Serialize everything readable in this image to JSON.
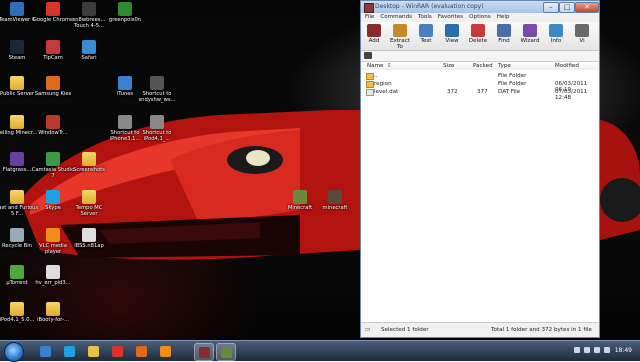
{
  "desktop": {
    "icons": [
      {
        "label": "TeamViewer 6",
        "icon": "teamviewer-icon",
        "color": "#2c6fb7"
      },
      {
        "label": "Google Chrome",
        "icon": "chrome-icon",
        "color": "#d8342b"
      },
      {
        "label": "sn8wbrees... Touch 4-5...",
        "icon": "app-icon",
        "color": "#3c3c3c"
      },
      {
        "label": "greenpois0n",
        "icon": "greenpois0n-icon",
        "color": "#2f8a2f"
      },
      {
        "label": "Steam",
        "icon": "steam-icon",
        "color": "#1b2838"
      },
      {
        "label": "TipCam",
        "icon": "tipcam-icon",
        "color": "#c23a3a"
      },
      {
        "label": "Safari",
        "icon": "safari-icon",
        "color": "#3a8bd6"
      },
      {
        "label": "Public Server",
        "icon": "folder-icon",
        "color": "#e8c04a"
      },
      {
        "label": "Samsung Kies",
        "icon": "kies-icon",
        "color": "#e06a1b"
      },
      {
        "label": "iTunes",
        "icon": "itunes-icon",
        "color": "#3d7fd1"
      },
      {
        "label": "Shortcut to sndyshw_ws...",
        "icon": "shortcut-icon",
        "color": "#555555"
      },
      {
        "label": "Selling Minecr...",
        "icon": "folder-icon",
        "color": "#e8c04a"
      },
      {
        "label": "WindowTr...",
        "icon": "windowtrans-icon",
        "color": "#b73a2a"
      },
      {
        "label": "Shortcut to iPhone3,1...",
        "icon": "shortcut-icon",
        "color": "#888888"
      },
      {
        "label": "Shortcut to iPod4,1_...",
        "icon": "shortcut-icon",
        "color": "#888888"
      },
      {
        "label": "Flatgrass...",
        "icon": "flatgrass-icon",
        "color": "#6b3fa0"
      },
      {
        "label": "Camtasia Studio 7",
        "icon": "camtasia-icon",
        "color": "#3a9a4a"
      },
      {
        "label": "Screenshots",
        "icon": "folder-icon",
        "color": "#e8c04a"
      },
      {
        "label": "Fast and Furious 5 F...",
        "icon": "folder-icon",
        "color": "#e8c04a"
      },
      {
        "label": "Skype",
        "icon": "skype-icon",
        "color": "#1fa0e0"
      },
      {
        "label": "Tempo MC Server",
        "icon": "folder-icon",
        "color": "#e8c04a"
      },
      {
        "label": "Minecraft",
        "icon": "minecraft-icon",
        "color": "#6a8a3a"
      },
      {
        "label": "minecraft",
        "icon": "minecraft-icon",
        "color": "#5a4a3a"
      },
      {
        "label": "Recycle Bin",
        "icon": "recycle-bin-icon",
        "color": "#9aa9b8"
      },
      {
        "label": "VLC media player",
        "icon": "vlc-icon",
        "color": "#f08c1a"
      },
      {
        "label": "iBSS.n81ap",
        "icon": "file-icon",
        "color": "#dddddd"
      },
      {
        "label": "µTorrent",
        "icon": "utorrent-icon",
        "color": "#4caa3c"
      },
      {
        "label": "hv_err_pid3...",
        "icon": "file-icon",
        "color": "#dddddd"
      },
      {
        "label": "iPod4,1_5.0...",
        "icon": "folder-icon",
        "color": "#e8c04a"
      },
      {
        "label": "iBooty-for-...",
        "icon": "folder-icon",
        "color": "#e8c04a"
      }
    ]
  },
  "winrar": {
    "title": "Desktop - WinRAR (evaluation copy)",
    "menu": [
      "File",
      "Commands",
      "Tools",
      "Favorites",
      "Options",
      "Help"
    ],
    "toolbar": [
      "Add",
      "Extract To",
      "Test",
      "View",
      "Delete",
      "Find",
      "Wizard",
      "Info",
      "Vi"
    ],
    "toolbar_colors": [
      "#8a2b2b",
      "#c78a2b",
      "#4a7fc1",
      "#2b6fa8",
      "#c73a3a",
      "#4a6fa8",
      "#7a4aa8",
      "#3a8ac1",
      "#6a6a6a"
    ],
    "columns": [
      "Name",
      "Size",
      "Packed",
      "Type",
      "Modified"
    ],
    "rows": [
      {
        "name": "..",
        "size": "",
        "packed": "",
        "type": "File Folder",
        "modified": "",
        "kind": "folder"
      },
      {
        "name": "region",
        "size": "",
        "packed": "",
        "type": "File Folder",
        "modified": "06/03/2011 06:19",
        "kind": "folder"
      },
      {
        "name": "level.dat",
        "size": "372",
        "packed": "377",
        "type": "DAT File",
        "modified": "07/03/2011 12:48",
        "kind": "file"
      }
    ],
    "status_left": "Selected 1 folder",
    "status_right": "Total 1 folder and 372 bytes in 1 file"
  },
  "taskbar": {
    "apps": [
      {
        "name": "ie-taskbar-icon",
        "color": "#3a7fd1"
      },
      {
        "name": "skype-taskbar-icon",
        "color": "#1fa0e0"
      },
      {
        "name": "explorer-taskbar-icon",
        "color": "#e8c04a"
      },
      {
        "name": "chrome-taskbar-icon",
        "color": "#d8342b"
      },
      {
        "name": "kies-taskbar-icon",
        "color": "#e06a1b"
      },
      {
        "name": "vlc-taskbar-icon",
        "color": "#f08c1a"
      },
      {
        "name": "winrar-taskbar-icon",
        "color": "#8a2b2b"
      },
      {
        "name": "minecraft-taskbar-icon",
        "color": "#6a8a3a"
      }
    ],
    "clock": "18:49"
  }
}
